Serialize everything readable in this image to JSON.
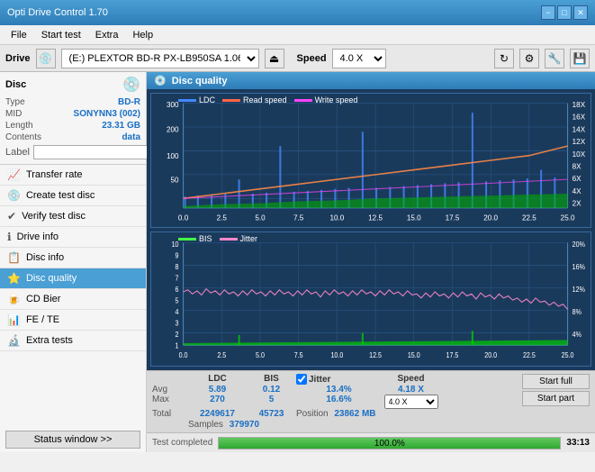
{
  "window": {
    "title": "Opti Drive Control 1.70",
    "min_btn": "−",
    "max_btn": "□",
    "close_btn": "✕"
  },
  "menu": {
    "items": [
      "File",
      "Start test",
      "Extra",
      "Help"
    ]
  },
  "drive_bar": {
    "label": "Drive",
    "drive_value": "(E:)  PLEXTOR BD-R  PX-LB950SA 1.06",
    "speed_label": "Speed",
    "speed_value": "4.0 X"
  },
  "disc": {
    "title": "Disc",
    "type_label": "Type",
    "type_val": "BD-R",
    "mid_label": "MID",
    "mid_val": "SONYNN3 (002)",
    "length_label": "Length",
    "length_val": "23.31 GB",
    "contents_label": "Contents",
    "contents_val": "data",
    "label_label": "Label"
  },
  "nav": {
    "items": [
      {
        "id": "transfer-rate",
        "label": "Transfer rate",
        "icon": "📈"
      },
      {
        "id": "create-test-disc",
        "label": "Create test disc",
        "icon": "💿"
      },
      {
        "id": "verify-test-disc",
        "label": "Verify test disc",
        "icon": "✔"
      },
      {
        "id": "drive-info",
        "label": "Drive info",
        "icon": "ℹ"
      },
      {
        "id": "disc-info",
        "label": "Disc info",
        "icon": "📋"
      },
      {
        "id": "disc-quality",
        "label": "Disc quality",
        "icon": "⭐",
        "active": true
      },
      {
        "id": "cd-bier",
        "label": "CD Bier",
        "icon": "🍺"
      },
      {
        "id": "fe-te",
        "label": "FE / TE",
        "icon": "📊"
      },
      {
        "id": "extra-tests",
        "label": "Extra tests",
        "icon": "🔬"
      }
    ],
    "status_btn": "Status window >>"
  },
  "quality": {
    "title": "Disc quality",
    "legend_ldc": "LDC",
    "legend_read": "Read speed",
    "legend_write": "Write speed",
    "legend_bis": "BIS",
    "legend_jitter": "Jitter",
    "chart1": {
      "y_max": 300,
      "y_right_max": 18,
      "x_max": 25,
      "x_labels": [
        "0.0",
        "2.5",
        "5.0",
        "7.5",
        "10.0",
        "12.5",
        "15.0",
        "17.5",
        "20.0",
        "22.5",
        "25.0"
      ],
      "y_labels_left": [
        "300",
        "200",
        "100",
        "50"
      ],
      "y_labels_right": [
        "18X",
        "16X",
        "14X",
        "12X",
        "10X",
        "8X",
        "6X",
        "4X",
        "2X"
      ]
    },
    "chart2": {
      "y_max": 10,
      "y_right_max": 20,
      "x_max": 25,
      "x_labels": [
        "0.0",
        "2.5",
        "5.0",
        "7.5",
        "10.0",
        "12.5",
        "15.0",
        "17.5",
        "20.0",
        "22.5",
        "25.0"
      ],
      "y_labels_left": [
        "10",
        "9",
        "8",
        "7",
        "6",
        "5",
        "4",
        "3",
        "2",
        "1"
      ],
      "y_labels_right": [
        "20%",
        "16%",
        "12%",
        "8%",
        "4%"
      ]
    }
  },
  "stats": {
    "col_ldc": "LDC",
    "col_bis": "BIS",
    "col_jitter": "Jitter",
    "col_speed": "Speed",
    "col_position": "Position",
    "row_avg": "Avg",
    "row_max": "Max",
    "row_total": "Total",
    "ldc_avg": "5.89",
    "ldc_max": "270",
    "ldc_total": "2249617",
    "bis_avg": "0.12",
    "bis_max": "5",
    "bis_total": "45723",
    "jitter_avg": "13.4%",
    "jitter_max": "16.6%",
    "jitter_total": "",
    "jitter_checked": true,
    "speed_val": "4.18 X",
    "speed_select": "4.0 X",
    "position_val": "23862 MB",
    "samples_label": "Samples",
    "samples_val": "379970",
    "start_full_btn": "Start full",
    "start_part_btn": "Start part"
  },
  "progress": {
    "status_text": "Test completed",
    "percent": 100,
    "percent_text": "100.0%",
    "time": "33:13"
  }
}
